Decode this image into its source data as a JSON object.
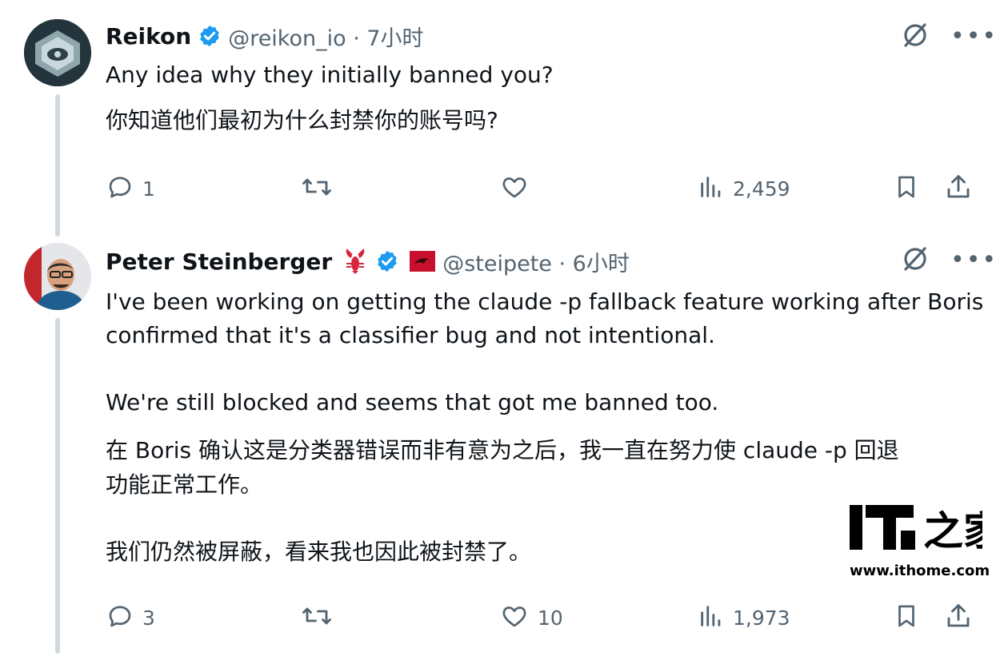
{
  "tweets": [
    {
      "name": "Reikon",
      "handle_time": "@reikon_io · 7小时",
      "lines": [
        "Any idea why they initially banned you?",
        "你知道他们最初为什么封禁你的账号吗?"
      ],
      "replies": "1",
      "retweets": "",
      "likes": "",
      "views": "2,459"
    },
    {
      "name": "Peter Steinberger",
      "handle_time": "@steipete · 6小时",
      "lines": [
        "I've been working on getting the claude -p fallback feature working after Boris",
        "confirmed that it's a classifier bug and not intentional.",
        "We're still blocked and seems that got me banned too.",
        "在 Boris 确认这是分类器错误而非有意为之后，我一直在努力使 claude -p 回退",
        "功能正常工作。",
        "我们仍然被屏蔽，看来我也因此被封禁了。"
      ],
      "replies": "3",
      "retweets": "",
      "likes": "10",
      "views": "1,973"
    }
  ],
  "watermark": {
    "logo_text": "IT之家",
    "url": "www.ithome.com"
  },
  "colors": {
    "verified": "#1d9bf0",
    "muted": "#536471",
    "text": "#0f1419",
    "thread": "#cfd9de"
  },
  "icons": [
    "grok-icon",
    "more-icon",
    "reply-icon",
    "retweet-icon",
    "like-icon",
    "views-icon",
    "bookmark-icon",
    "share-icon",
    "verified-badge-icon",
    "lobster-emoji-icon",
    "flag-icon"
  ]
}
